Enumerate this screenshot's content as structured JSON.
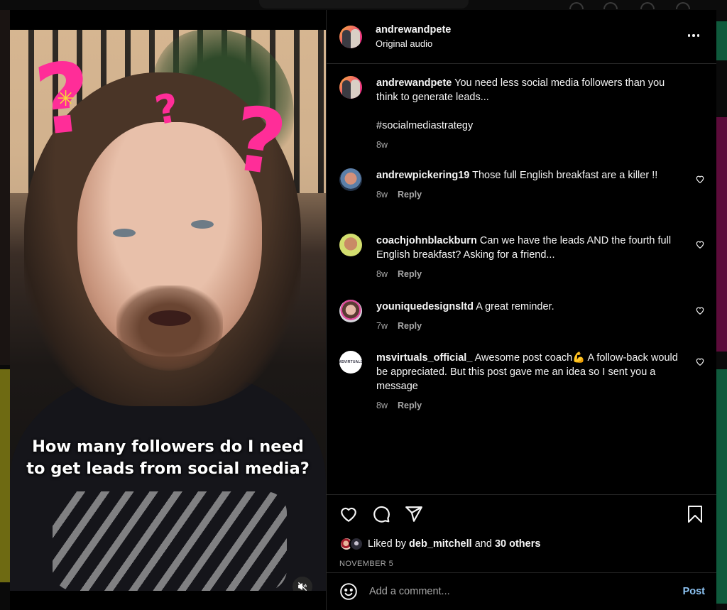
{
  "post": {
    "author": "andrewandpete",
    "audio_label": "Original audio",
    "more_icon": "more-horizontal-icon",
    "caption": {
      "username": "andrewandpete",
      "text": "You need less social media followers than you think to generate leads...",
      "hashtag": "#socialmediastrategy",
      "time": "8w"
    },
    "video": {
      "overlay_text": "How many followers do I need to get leads from social media?",
      "mute_icon": "speaker-muted-icon"
    }
  },
  "comments": [
    {
      "username": "andrewpickering19",
      "text": "Those full English breakfast are a killer !!",
      "time": "8w",
      "reply_label": "Reply",
      "like_icon": "heart-outline-icon"
    },
    {
      "username": "coachjohnblackburn",
      "text": "Can we have the leads AND the fourth full English breakfast? Asking for a friend...",
      "time": "8w",
      "reply_label": "Reply",
      "like_icon": "heart-outline-icon"
    },
    {
      "username": "youniquedesignsltd",
      "text": "A great reminder.",
      "time": "7w",
      "reply_label": "Reply",
      "like_icon": "heart-outline-icon"
    },
    {
      "username": "msvirtuals_official_",
      "text": "Awesome post coach💪 A follow-back would be appreciated. But this post gave me an idea so I sent you a message",
      "time": "8w",
      "reply_label": "Reply",
      "like_icon": "heart-outline-icon",
      "avatar_text": "MSVIRTUALS"
    }
  ],
  "actions": {
    "icons": [
      "heart-outline-icon",
      "comment-icon",
      "share-paper-plane-icon",
      "bookmark-icon"
    ],
    "liked_by_prefix": "Liked by",
    "liked_by_user": "deb_mitchell",
    "liked_by_joiner": "and",
    "liked_by_others": "30 others",
    "date": "NOVEMBER 5"
  },
  "add_comment": {
    "emoji_icon": "emoji-smile-icon",
    "placeholder": "Add a comment...",
    "post_label": "Post"
  },
  "colors": {
    "background": "#000000",
    "divider": "#262626",
    "secondary_text": "#a8a8a8",
    "post_button": "#8ec5f5",
    "sticker_pink": "#ff2d98"
  }
}
